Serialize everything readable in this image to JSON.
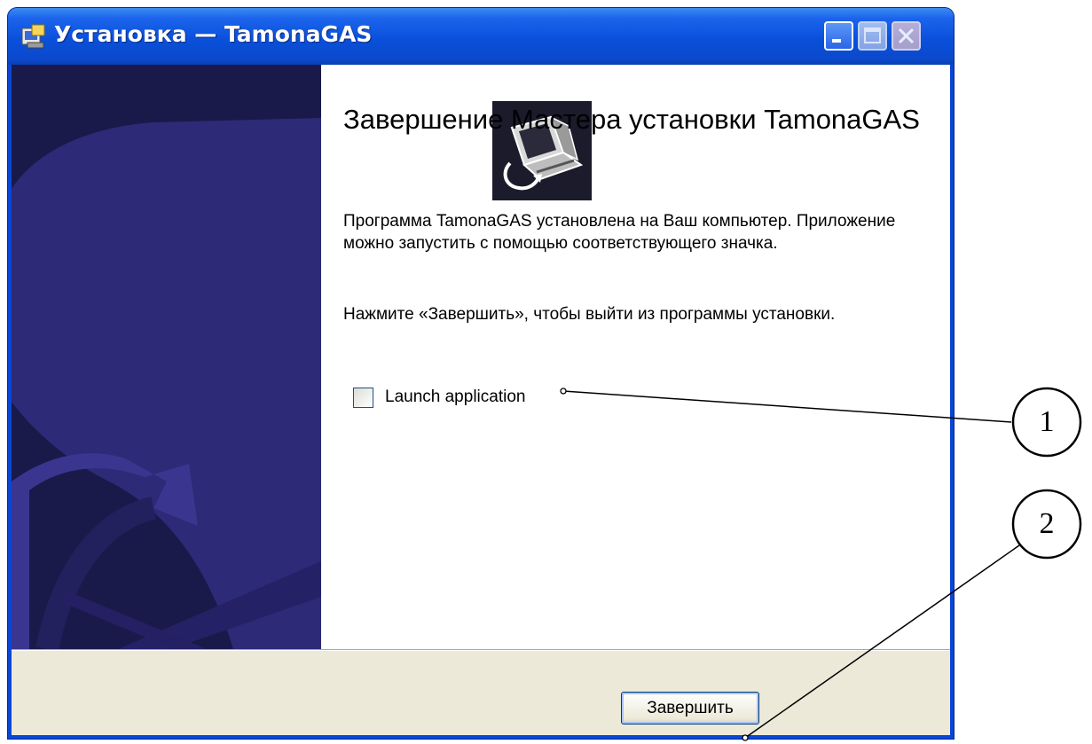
{
  "window": {
    "title": "Установка — TamonaGAS",
    "controls": {
      "minimize": "minimize",
      "maximize": "maximize",
      "close": "close"
    }
  },
  "wizard": {
    "heading": "Завершение Мастера установки TamonaGAS",
    "paragraph_1": "Программа TamonaGAS установлена на Ваш компьютер. Приложение можно запустить с помощью соответствующего значка.",
    "paragraph_2": "Нажмите «Завершить», чтобы выйти из программы установки.",
    "launch_checkbox": {
      "label": "Launch application",
      "checked": false
    },
    "finish_button": "Завершить"
  },
  "callouts": [
    {
      "number": "1",
      "target": "launch-application-checkbox"
    },
    {
      "number": "2",
      "target": "finish-button"
    }
  ],
  "colors": {
    "titlebar": "#0a50db",
    "side_panel": "#1a1a4a",
    "side_panel_shape": "#2e2a78",
    "dialog_face": "#ece9d8"
  },
  "icons": [
    "setup-app-icon",
    "computer-install-icon"
  ]
}
